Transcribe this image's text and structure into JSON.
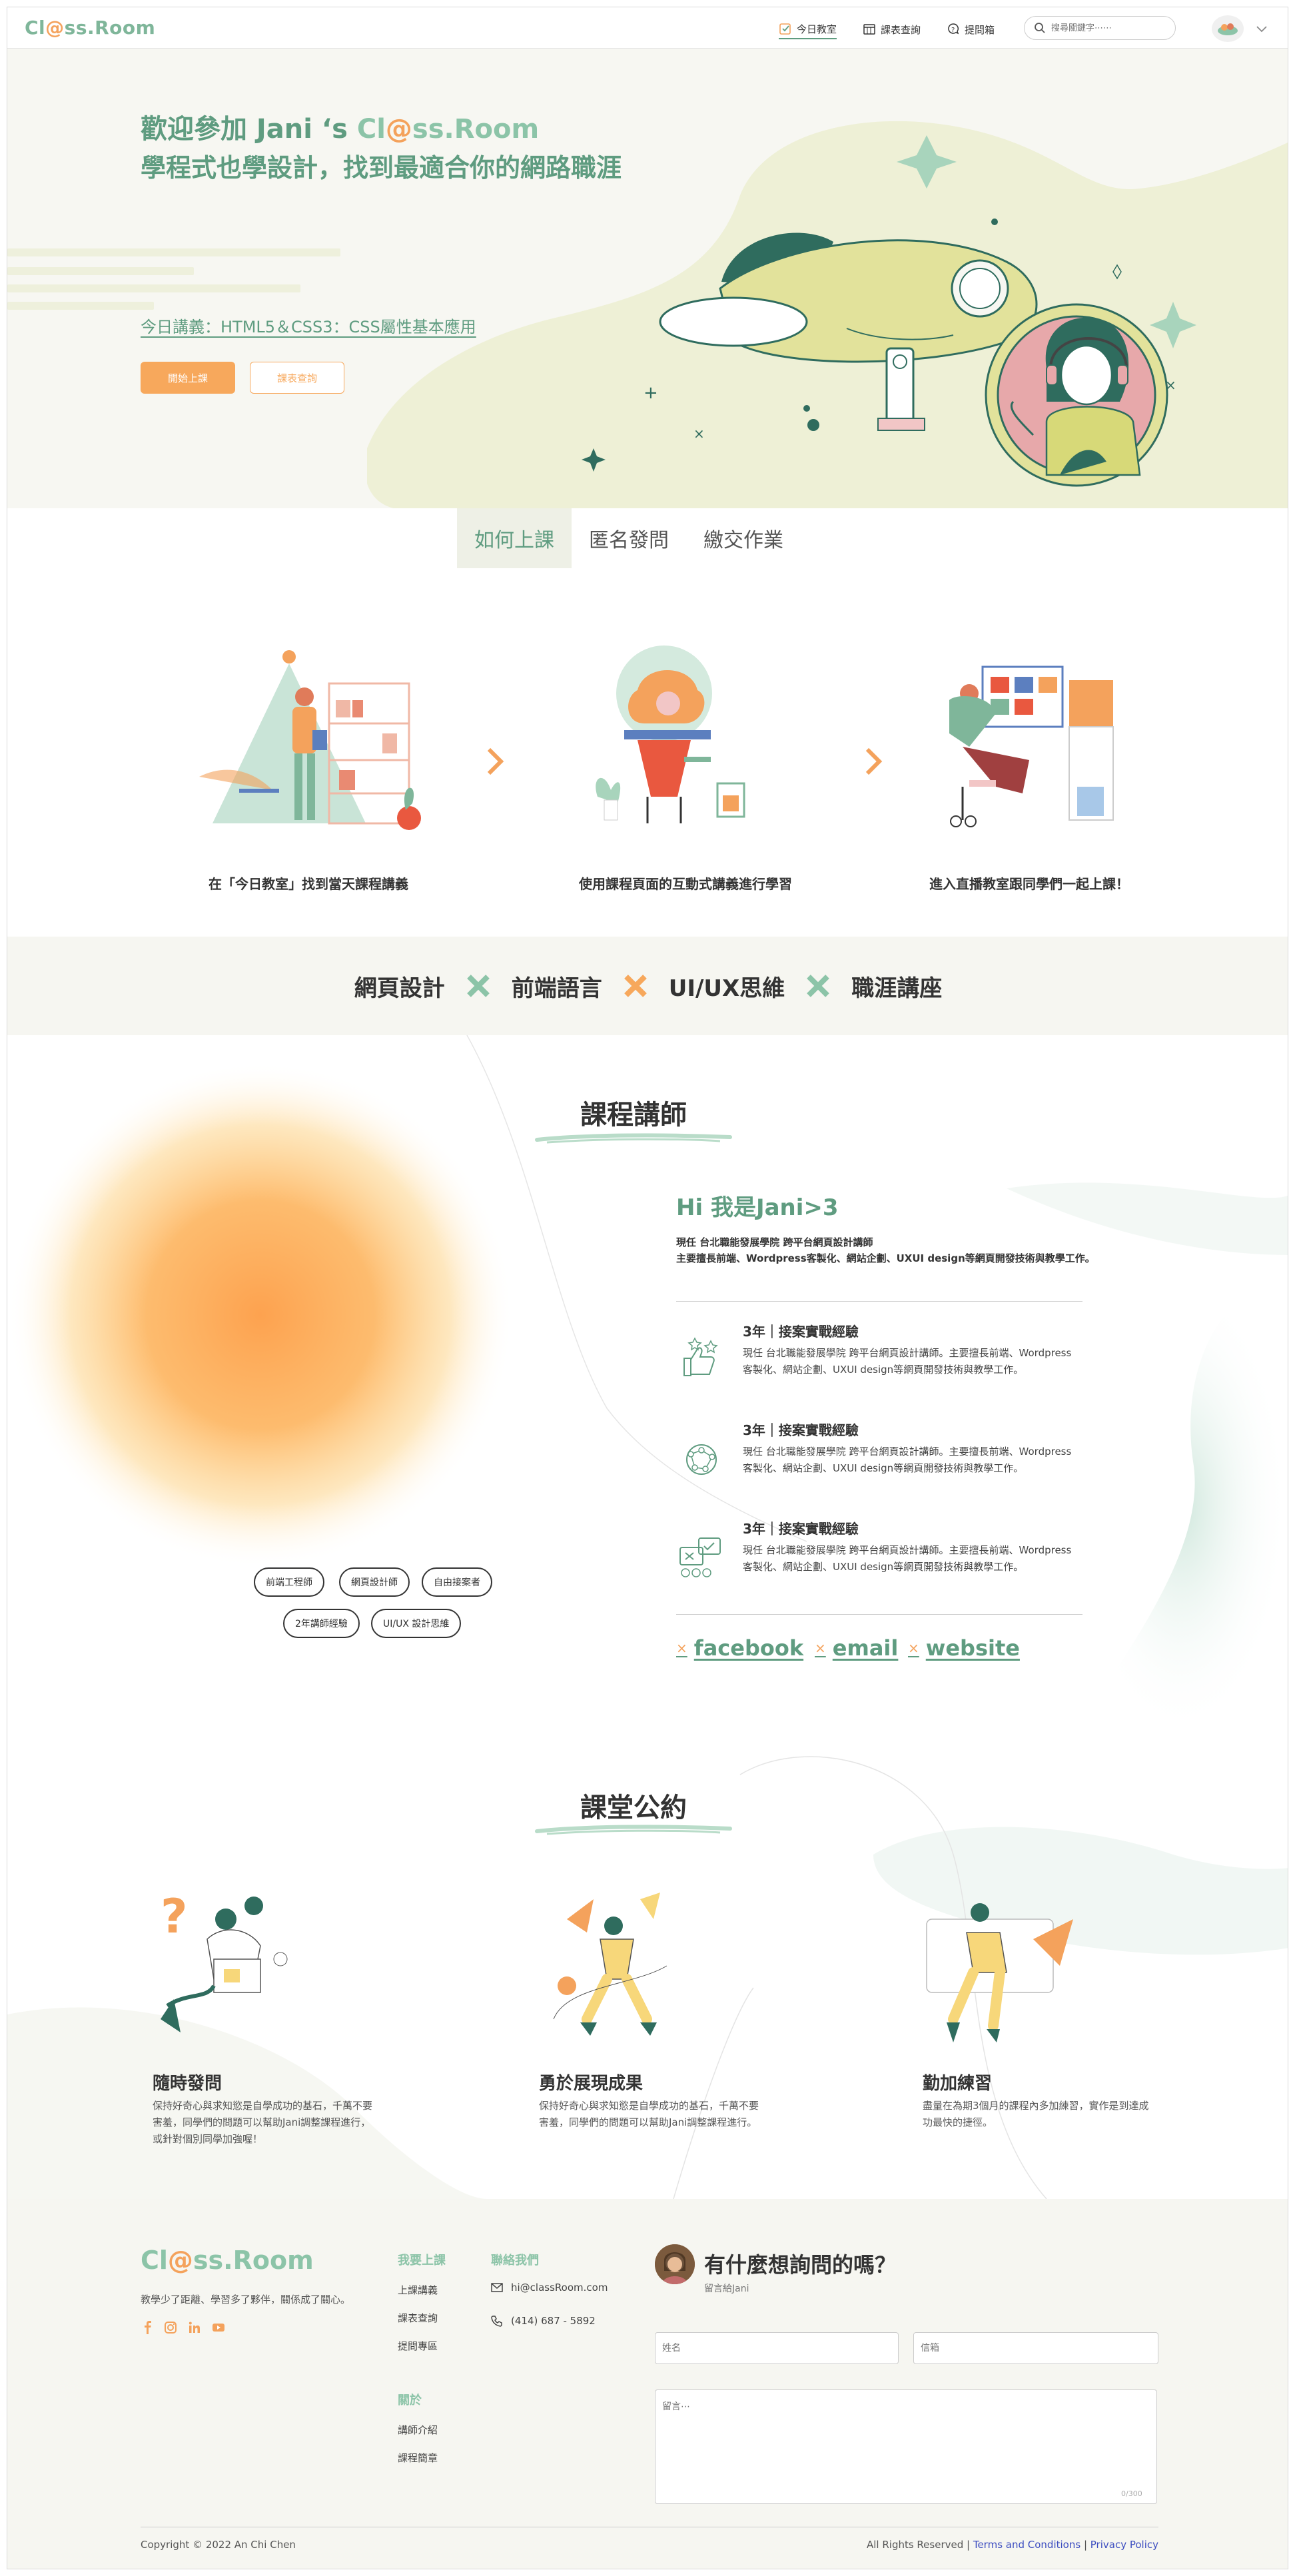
{
  "nav": {
    "logo_pre": "Cl",
    "logo_at": "@",
    "logo_post": "ss.Room",
    "items": [
      {
        "label": "今日教室",
        "icon": "check-square-icon"
      },
      {
        "label": "課表查詢",
        "icon": "calendar-icon"
      },
      {
        "label": "提問箱",
        "icon": "question-bubble-icon"
      }
    ],
    "search_placeholder": "搜尋關鍵字⋯⋯"
  },
  "hero": {
    "title_prefix": "歡迎參加 Jani ‘s ",
    "title_logo_pre": "Cl",
    "title_logo_at": "@",
    "title_logo_post": "ss.Room",
    "subtitle": "學程式也學設計，找到最適合你的網路職涯",
    "today_lecture": "今日講義：HTML5＆CSS3：CSS屬性基本應用",
    "btn_start": "開始上課",
    "btn_schedule": "課表查詢"
  },
  "tabs": [
    "如何上課",
    "匿名發問",
    "繳交作業"
  ],
  "steps": [
    {
      "caption": "在「今日教室」找到當天課程講義"
    },
    {
      "caption": "使用課程頁面的互動式講義進行學習"
    },
    {
      "caption": "進入直播教室跟同學們一起上課！"
    }
  ],
  "topics": [
    "網頁設計",
    "前端語言",
    "UI/UX思維",
    "職涯講座"
  ],
  "teacher": {
    "section_title": "課程講師",
    "hi": "Hi  我是Jani>3",
    "intro_line1": "現任 台北職能發展學院 跨平台網頁設計講師",
    "intro_line2": "主要擅長前端、Wordpress客製化、網站企劃、UXUI design等網頁開發技術與教學工作。",
    "experiences": [
      {
        "title": "3年｜接案實戰經驗",
        "desc": "現任 台北職能發展學院 跨平台網頁設計講師。主要擅長前端、Wordpress客製化、網站企劃、UXUI design等網頁開發技術與教學工作。"
      },
      {
        "title": "3年｜接案實戰經驗",
        "desc": "現任 台北職能發展學院 跨平台網頁設計講師。主要擅長前端、Wordpress客製化、網站企劃、UXUI design等網頁開發技術與教學工作。"
      },
      {
        "title": "3年｜接案實戰經驗",
        "desc": "現任 台北職能發展學院 跨平台網頁設計講師。主要擅長前端、Wordpress客製化、網站企劃、UXUI design等網頁開發技術與教學工作。"
      }
    ],
    "tags": [
      "前端工程師",
      "網頁設計師",
      "自由接案者",
      "2年講師經驗",
      "UI/UX 設計思維"
    ],
    "links": [
      "facebook",
      "email",
      "website"
    ]
  },
  "rules": {
    "section_title": "課堂公約",
    "items": [
      {
        "title": "隨時發問",
        "desc": "保持好奇心與求知慾是自學成功的基石，千萬不要害羞，同學們的問題可以幫助Jani調整課程進行，或針對個別同學加強喔！"
      },
      {
        "title": "勇於展現成果",
        "desc": "保持好奇心與求知慾是自學成功的基石，千萬不要害羞，同學們的問題可以幫助Jani調整課程進行。"
      },
      {
        "title": "勤加練習",
        "desc": "盡量在為期3個月的課程內多加練習，實作是到達成功最快的捷徑。"
      }
    ]
  },
  "footer": {
    "logo_pre": "Cl",
    "logo_at": "@",
    "logo_post": "ss.Room",
    "tagline": "教學少了距離、學習多了夥伴，關係成了關心。",
    "col1_head": "我要上課",
    "col1_links": [
      "上課講義",
      "課表查詢",
      "提問專區"
    ],
    "col2_head": "關於",
    "col2_links": [
      "講師介紹",
      "課程簡章"
    ],
    "contact_head": "聯絡我們",
    "email": "hi@classRoom.com",
    "phone": "(414) 687 - 5892",
    "ask_title": "有什麼想詢問的嗎？",
    "ask_sub": "留言給Jani",
    "name_placeholder": "姓名",
    "mail_placeholder": "信箱",
    "message_placeholder": "留言⋯",
    "counter": "0/300",
    "copyright": "Copyright © 2022 An Chi Chen",
    "rights": "All Rights Reserved | ",
    "terms": "Terms and Conditions",
    "sep": " | ",
    "privacy": "Privacy Policy"
  },
  "colors": {
    "brand_green": "#5f9c80",
    "light_green": "#8cc4a8",
    "accent_orange": "#f7a85c",
    "hero_bg": "#f7f7f2",
    "blob_yellow": "#eef0d6"
  }
}
